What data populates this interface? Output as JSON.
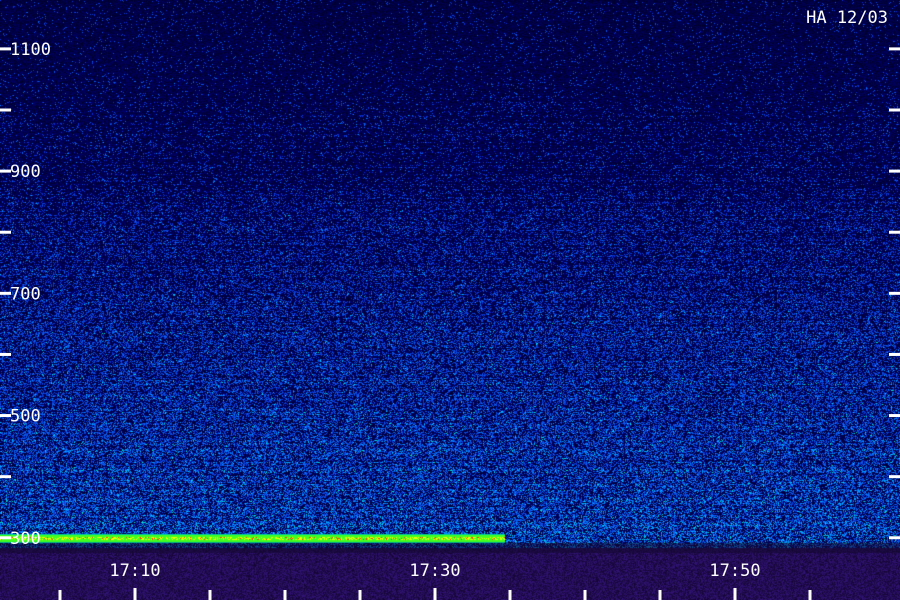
{
  "chart_data": {
    "type": "heatmap",
    "station_label": "HA 12/03",
    "y_axis": {
      "tick_labels": [
        "300",
        "500",
        "700",
        "900",
        "1100"
      ],
      "tick_values": [
        300,
        500,
        700,
        900,
        1100
      ],
      "minor_tick_values": [
        400,
        600,
        800,
        1000
      ],
      "range": [
        280,
        1180
      ]
    },
    "x_axis": {
      "tick_labels": [
        "17:10",
        "17:30",
        "17:50"
      ],
      "tick_values": [
        10,
        30,
        50
      ],
      "minor_tick_values": [
        5,
        15,
        20,
        25,
        35,
        40,
        45,
        55
      ],
      "range": [
        1,
        61
      ]
    },
    "features": [
      {
        "description": "intense emission band",
        "y_value": 300,
        "x_start": 1,
        "x_end": 34.6
      }
    ],
    "colors": {
      "background_low": "#00003a",
      "noise_mid": "#1e6bff",
      "noise_high": "#00e0c0",
      "band_green": "#40ff20",
      "band_yellow": "#f0ff00",
      "band_red": "#ff4000",
      "below_band": "#140830"
    },
    "grid": false
  }
}
